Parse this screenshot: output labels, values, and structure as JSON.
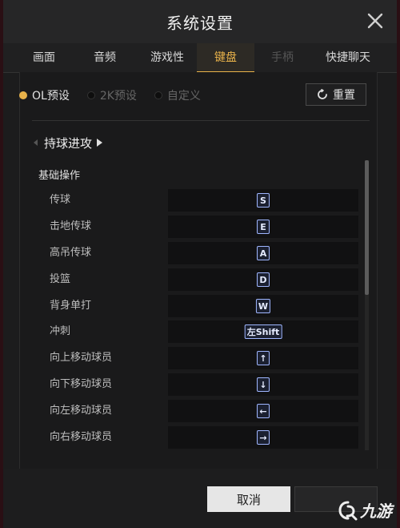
{
  "window": {
    "title": "系统设置"
  },
  "tabs": [
    {
      "label": "画面",
      "state": "normal"
    },
    {
      "label": "音频",
      "state": "normal"
    },
    {
      "label": "游戏性",
      "state": "normal"
    },
    {
      "label": "键盘",
      "state": "active"
    },
    {
      "label": "手柄",
      "state": "disabled"
    },
    {
      "label": "快捷聊天",
      "state": "normal"
    }
  ],
  "presets": [
    {
      "label": "OL预设",
      "selected": true
    },
    {
      "label": "2K预设",
      "selected": false
    },
    {
      "label": "自定义",
      "selected": false
    }
  ],
  "reset_label": "重置",
  "category": "持球进攻",
  "section_title": "基础操作",
  "bindings": [
    {
      "action": "传球",
      "key": "S"
    },
    {
      "action": "击地传球",
      "key": "E"
    },
    {
      "action": "高吊传球",
      "key": "A"
    },
    {
      "action": "投篮",
      "key": "D"
    },
    {
      "action": "背身单打",
      "key": "W"
    },
    {
      "action": "冲刺",
      "key": "左Shift"
    },
    {
      "action": "向上移动球员",
      "key": "↑"
    },
    {
      "action": "向下移动球员",
      "key": "↓"
    },
    {
      "action": "向左移动球员",
      "key": "←"
    },
    {
      "action": "向右移动球员",
      "key": "→"
    }
  ],
  "footer": {
    "cancel_label": "取消"
  },
  "watermark": {
    "text": "九游"
  },
  "colors": {
    "accent": "#e8b24a",
    "keycap_border": "#9fb6ff",
    "background": "#1c1c1d"
  }
}
